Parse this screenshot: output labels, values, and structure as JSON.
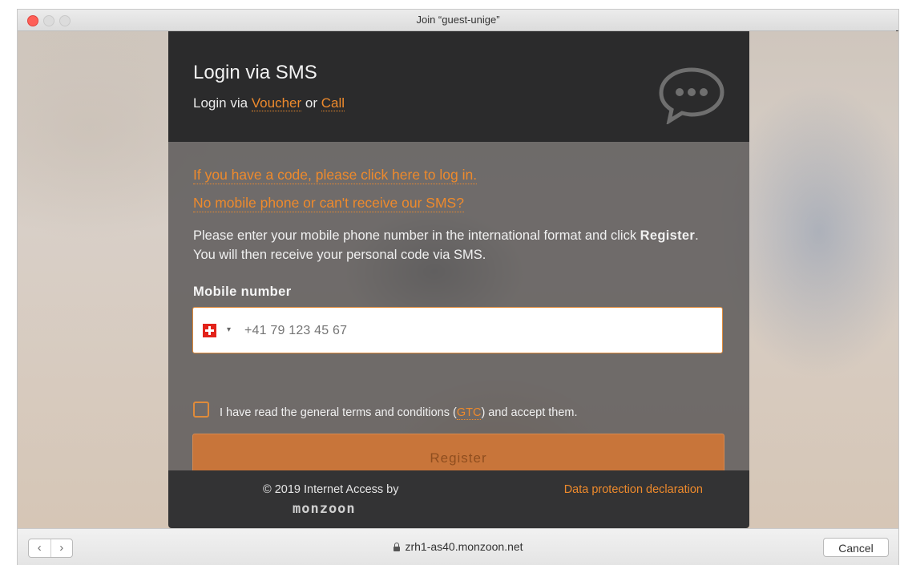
{
  "window": {
    "title": "Join “guest-unige”"
  },
  "card": {
    "title": "Login via SMS",
    "subtitle_prefix": "Login via ",
    "voucher_link": "Voucher",
    "subtitle_or": " or ",
    "call_link": "Call",
    "code_link": "If you have a code, please click here to log in.",
    "no_sms_link": "No mobile phone or can't receive our SMS?",
    "instructions_part1": "Please enter your mobile phone number in the international format and click ",
    "instructions_bold": "Register",
    "instructions_part2": ". You will then receive your personal code via SMS.",
    "field_label": "Mobile number",
    "phone_placeholder": "+41 79 123 45 67",
    "phone_value": "",
    "country_caret": "▾",
    "terms_prefix": "I have read the general terms and conditions (",
    "terms_link": "GTC",
    "terms_suffix": ") and accept them.",
    "terms_checked": false,
    "register_label": "Register"
  },
  "footer": {
    "copyright": "© 2019 Internet Access by",
    "logo_text": "monzoon",
    "privacy_link": "Data protection declaration"
  },
  "bottombar": {
    "back_glyph": "‹",
    "forward_glyph": "›",
    "url": "zrh1-as40.monzoon.net",
    "cancel_label": "Cancel"
  },
  "colors": {
    "accent": "#ee8a2c",
    "header_bg": "#2b2b2c",
    "register_bg": "#c8753a"
  },
  "icons": [
    "chat-bubble-icon",
    "swiss-flag-icon",
    "lock-icon",
    "back-icon",
    "forward-icon"
  ]
}
